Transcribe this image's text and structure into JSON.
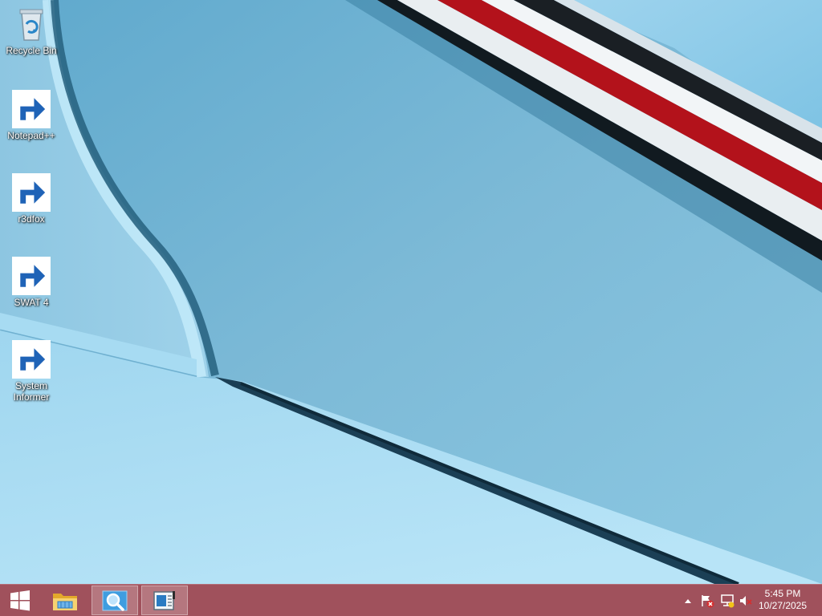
{
  "desktop": {
    "icons": [
      {
        "label": "Recycle Bin",
        "icon": "recycle-bin-icon"
      },
      {
        "label": "Notepad++",
        "icon": "notepad-plus-plus-icon"
      },
      {
        "label": "r3dfox",
        "icon": "r3dfox-icon"
      },
      {
        "label": "SWAT 4",
        "icon": "swat4-icon"
      },
      {
        "label": "System Informer",
        "icon": "system-informer-icon"
      }
    ]
  },
  "taskbar": {
    "pinned": [
      {
        "icon": "start-windows-icon"
      },
      {
        "icon": "file-explorer-icon"
      },
      {
        "icon": "search-magnifier-icon"
      },
      {
        "icon": "control-panel-icon"
      }
    ],
    "tray": {
      "icons": [
        "show-hidden-icons-chevron",
        "action-center-flag-icon",
        "network-icon",
        "volume-muted-icon"
      ]
    },
    "clock": {
      "time": "5:45 PM",
      "date": "10/27/2025"
    }
  },
  "colors": {
    "taskbar": "#a0515c",
    "wallpaper_light": "#b5e2f6",
    "wallpaper_mid": "#7dbad7",
    "stripe_red": "#b3121b"
  }
}
